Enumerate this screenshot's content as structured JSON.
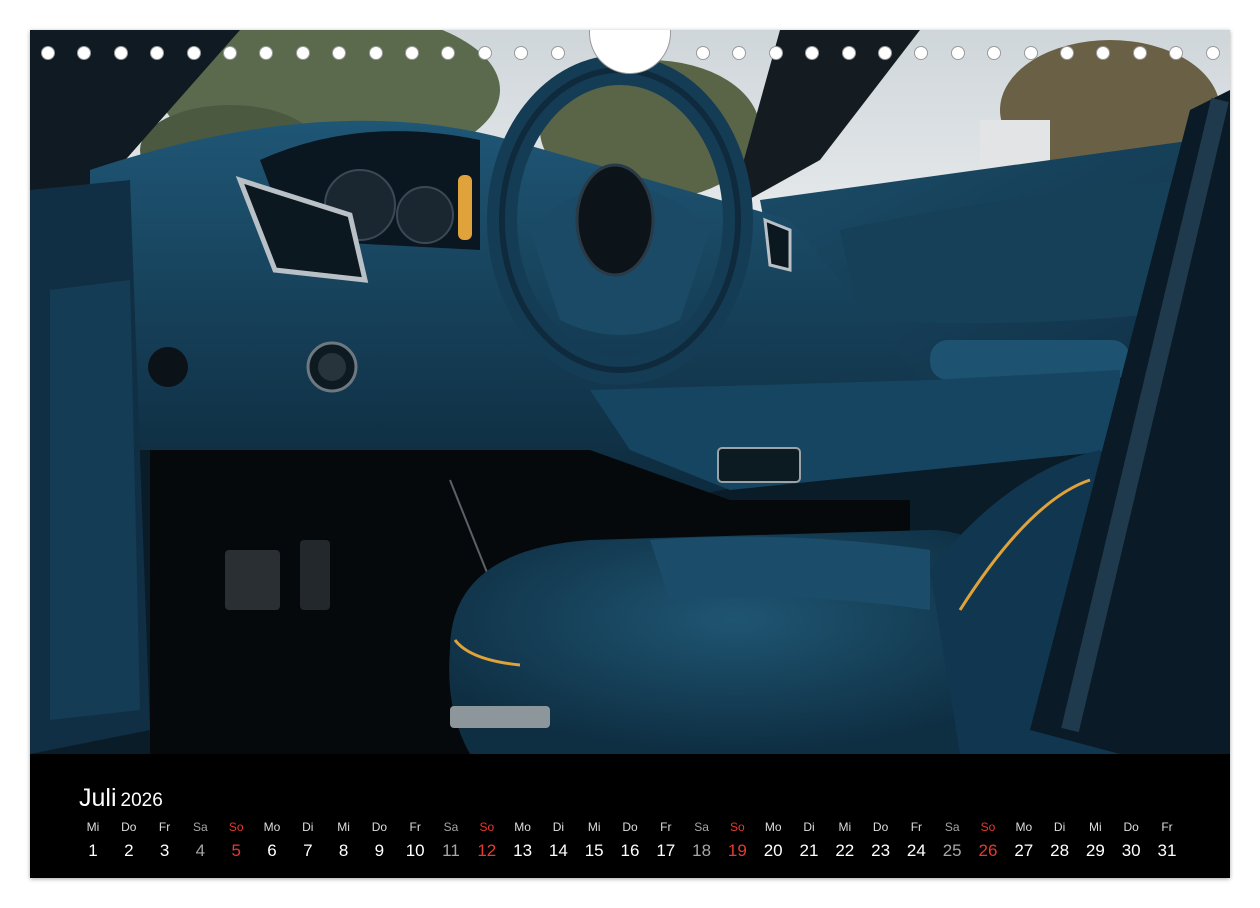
{
  "calendar": {
    "month": "Juli",
    "year": "2026",
    "weekdays": [
      "Mi",
      "Do",
      "Fr",
      "Sa",
      "So",
      "Mo",
      "Di",
      "Mi",
      "Do",
      "Fr",
      "Sa",
      "So",
      "Mo",
      "Di",
      "Mi",
      "Do",
      "Fr",
      "Sa",
      "So",
      "Mo",
      "Di",
      "Mi",
      "Do",
      "Fr",
      "Sa",
      "So",
      "Mo",
      "Di",
      "Mi",
      "Do",
      "Fr"
    ],
    "days": [
      "1",
      "2",
      "3",
      "4",
      "5",
      "6",
      "7",
      "8",
      "9",
      "10",
      "11",
      "12",
      "13",
      "14",
      "15",
      "16",
      "17",
      "18",
      "19",
      "20",
      "21",
      "22",
      "23",
      "24",
      "25",
      "26",
      "27",
      "28",
      "29",
      "30",
      "31"
    ]
  },
  "colors": {
    "background": "#000000",
    "sunday": "#e43b2f",
    "saturday": "#a6a6a6",
    "weekday": "#ffffff",
    "leather": "#1d4f6a",
    "stitching": "#e0a23a"
  },
  "photo": {
    "subject": "car-interior-blue-leather"
  }
}
